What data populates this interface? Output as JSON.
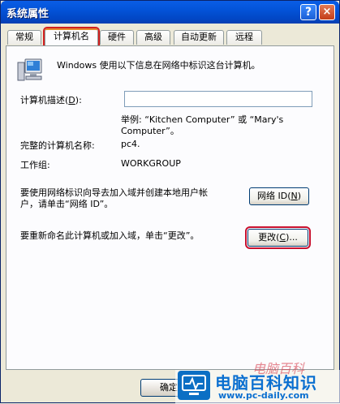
{
  "window": {
    "title": "系统属性",
    "help_glyph": "?",
    "close_glyph": "×"
  },
  "tabs": [
    {
      "label": "常规"
    },
    {
      "label": "计算机名"
    },
    {
      "label": "硬件"
    },
    {
      "label": "高级"
    },
    {
      "label": "自动更新"
    },
    {
      "label": "远程"
    }
  ],
  "panel": {
    "intro": "Windows 使用以下信息在网络中标识这台计算机。",
    "desc_label": "计算机描述",
    "desc_hotkey": "D",
    "desc_value": "",
    "example_line1": "举例: “Kitchen Computer” 或 “Mary's",
    "example_line2": "Computer”。",
    "fullname_label": "完整的计算机名称:",
    "fullname_value": "pc4.",
    "workgroup_label": "工作组:",
    "workgroup_value": "WORKGROUP",
    "network_text_line1": "要使用网络标识向导去加入域并创建本地用户帐",
    "network_text_line2": "户，请单击“网络 ID”。",
    "network_button": "网络 ID",
    "network_hotkey": "N",
    "rename_text": "要重新命名此计算机或加入域，单击“更改”。",
    "change_button": "更改",
    "change_hotkey": "C",
    "change_suffix": "..."
  },
  "footer": {
    "ok_button": "确定"
  },
  "watermark": {
    "title": "电脑百科知识",
    "url": "www.pc-daily.com",
    "handwriting": "电脑百科"
  }
}
